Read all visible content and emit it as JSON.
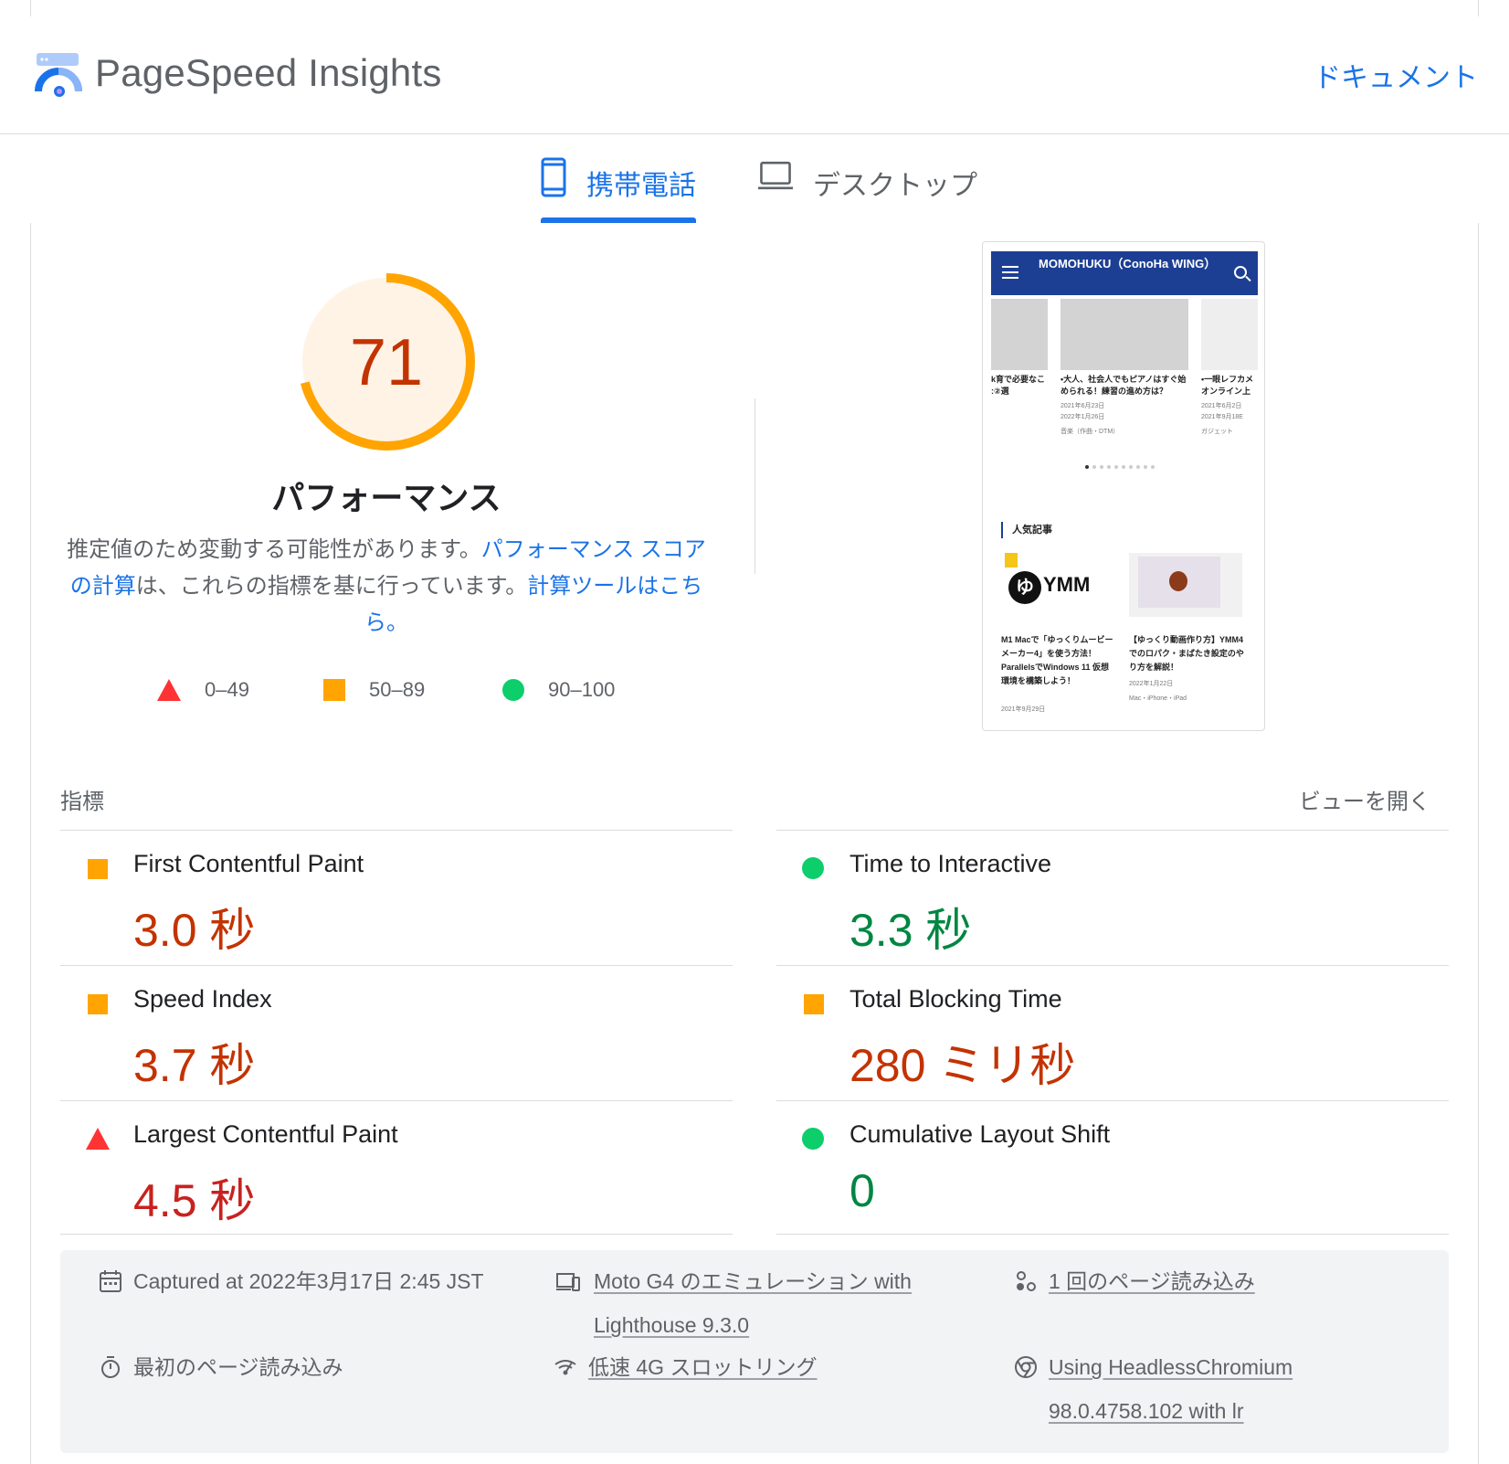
{
  "header": {
    "title": "PageSpeed Insights",
    "docs_link": "ドキュメント"
  },
  "tabs": [
    {
      "label": "携帯電話",
      "active": true
    },
    {
      "label": "デスクトップ",
      "active": false
    }
  ],
  "score": {
    "value": 71,
    "fraction": 0.71,
    "title": "パフォーマンス",
    "desc_1": "推定値のため変動する可能性があります。",
    "link_1": "パフォーマンス スコアの計算",
    "desc_2": "は、これらの指標を基に行っています。",
    "link_2": "計算ツールはこちら。"
  },
  "legend": [
    {
      "range": "0–49",
      "status": "fail"
    },
    {
      "range": "50–89",
      "status": "average"
    },
    {
      "range": "90–100",
      "status": "pass"
    }
  ],
  "preview": {
    "site_title": "MOMOHUKU（ConoHa WING）",
    "card1_title": "k育で必要なこ :②選",
    "card2_title": "•大人、社会人でもピアノはすぐ始められる！練習の進め方は？",
    "card2_date1": "2021年6月23日",
    "card2_date2": "2022年1月26日",
    "card2_category": "音楽（作曲・DTM）",
    "card3_title": "•一眼レフカメ オンライン上で",
    "card3_date1": "2021年6月2日",
    "card3_date2": "2021年9月18E",
    "card3_category": "ガジェット",
    "popular_heading": "人気記事",
    "pop1_logo": "YMM",
    "pop1_logo_char": "ゆ",
    "pop1_title": "M1 Macで「ゆっくりムービーメーカー4」を使う方法！ParallelsでWindows 11 仮想環境を構築しよう！",
    "pop1_date": "2021年9月29日",
    "pop2_title": "【ゆっくり動画作り方】YMM4でのロパク・まばたき設定のやり方を解説！",
    "pop2_date": "2022年1月22日",
    "pop2_category": "Mac・iPhone・iPad"
  },
  "metrics": {
    "title": "指標",
    "expand": "ビューを開く",
    "items": [
      {
        "name": "First Contentful Paint",
        "value": "3.0 秒",
        "status": "average"
      },
      {
        "name": "Time to Interactive",
        "value": "3.3 秒",
        "status": "pass"
      },
      {
        "name": "Speed Index",
        "value": "3.7 秒",
        "status": "average"
      },
      {
        "name": "Total Blocking Time",
        "value": "280 ミリ秒",
        "status": "average"
      },
      {
        "name": "Largest Contentful Paint",
        "value": "4.5 秒",
        "status": "fail"
      },
      {
        "name": "Cumulative Layout Shift",
        "value": "0",
        "status": "pass"
      }
    ]
  },
  "runtime": {
    "captured": "Captured at 2022年3月17日 2:45 JST",
    "emulation": "Moto G4 のエミュレーション with Lighthouse 9.3.0",
    "page_loads": "1 回のページ読み込み",
    "initial_load": "最初のページ読み込み",
    "throttling": "低速 4G スロットリング",
    "browser": "Using HeadlessChromium 98.0.4758.102 with lr"
  },
  "colors": {
    "accent": "#1a73e8",
    "fail": "#ff3333",
    "average": "#ffa400",
    "pass": "#0cce6b"
  }
}
